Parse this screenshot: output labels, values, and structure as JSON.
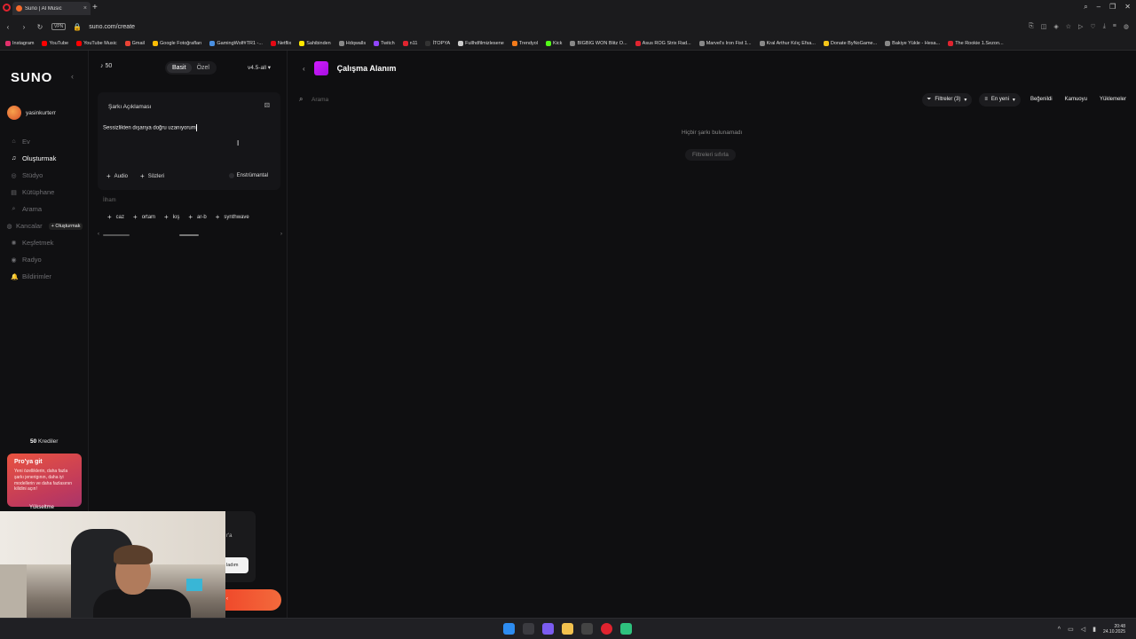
{
  "browser": {
    "tab_title": "Suno | AI Music",
    "url": "suno.com/create",
    "vpn_label": "VPN",
    "bookmarks": [
      {
        "label": "Instagram",
        "color": "#e1306c"
      },
      {
        "label": "YouTube",
        "color": "#ff0000"
      },
      {
        "label": "YouTube Music",
        "color": "#ff0000"
      },
      {
        "label": "Gmail",
        "color": "#ea4335"
      },
      {
        "label": "Google Fotoğrafları",
        "color": "#fbbc05"
      },
      {
        "label": "GamingWolf#TR1 -...",
        "color": "#4a90e2"
      },
      {
        "label": "Netflix",
        "color": "#e50914"
      },
      {
        "label": "Sahibinden",
        "color": "#ffe800"
      },
      {
        "label": "Hdqwalls",
        "color": "#888888"
      },
      {
        "label": "Twitch",
        "color": "#9146ff"
      },
      {
        "label": "n11",
        "color": "#e0242f"
      },
      {
        "label": "İTOPYA",
        "color": "#333333"
      },
      {
        "label": "Fullhdfilmizlesene",
        "color": "#cccccc"
      },
      {
        "label": "Trendyol",
        "color": "#f27a1a"
      },
      {
        "label": "Kick",
        "color": "#53fc18"
      },
      {
        "label": "BIGBIG WON Blitz O...",
        "color": "#888888"
      },
      {
        "label": "Asus ROG Strix Rad...",
        "color": "#e0242f"
      },
      {
        "label": "Marvel's Iron Fist 1...",
        "color": "#888888"
      },
      {
        "label": "Kral Arthur Kılıç Efsa...",
        "color": "#888888"
      },
      {
        "label": "Donate ByNoGame...",
        "color": "#f5c518"
      },
      {
        "label": "Bakiye Yükle - Hesa...",
        "color": "#888888"
      },
      {
        "label": "The Rookie 1.Sezon...",
        "color": "#e0242f"
      }
    ]
  },
  "sidebar": {
    "logo": "SUNO",
    "username": "yasinkurterr",
    "nav": [
      {
        "label": "Ev",
        "icon": "home-icon",
        "glyph": "⌂",
        "active": false
      },
      {
        "label": "Oluşturmak",
        "icon": "music-note-icon",
        "glyph": "♫",
        "active": true
      },
      {
        "label": "Stüdyo",
        "icon": "studio-icon",
        "glyph": "◎",
        "active": false
      },
      {
        "label": "Kütüphane",
        "icon": "library-icon",
        "glyph": "▤",
        "active": false
      },
      {
        "label": "Arama",
        "icon": "search-icon",
        "glyph": "⌕",
        "active": false
      }
    ],
    "hooks": {
      "label": "Kancalar",
      "badge": "+ Oluşturmak"
    },
    "nav2": [
      {
        "label": "Keşfetmek",
        "icon": "explore-icon",
        "glyph": "✺"
      },
      {
        "label": "Radyo",
        "icon": "radio-icon",
        "glyph": "◉"
      },
      {
        "label": "Bildirimler",
        "icon": "bell-icon",
        "glyph": "🔔"
      }
    ],
    "credits_count": "50",
    "credits_label": "Krediler",
    "pro": {
      "title": "Pro'ya git",
      "text": "Yeni özelliklerin, daha fazla şarkı jenerigının, daha iyi modellerin ve daha fazlasının kilidini açın!",
      "button": "Yükseltme"
    }
  },
  "overlay": {
    "popup_text": "r'a",
    "popup_button": "ladım"
  },
  "create": {
    "credits": "50",
    "mode_simple": "Basit",
    "mode_custom": "Özel",
    "version": "v4.5-all",
    "song_label": "Şarkı Açıklaması",
    "song_value": "Sessizlikten dışarıya doğru uzanıyorum",
    "chip_audio": "Audio",
    "chip_lyrics": "Sözleri",
    "instrumental": "Enstrümantal",
    "inspiration_label": "İlham",
    "tags": [
      "caz",
      "ortam",
      "kış",
      "ar-b",
      "synthwave"
    ]
  },
  "workspace": {
    "title": "Çalışma Alanım",
    "search_placeholder": "Arama",
    "filters_label": "Filtreler (3)",
    "sort_label": "En yeni",
    "liked_label": "Beğenildi",
    "public_label": "Kamuoyu",
    "uploads_label": "Yüklemeler",
    "empty_message": "Hiçbir şarkı bulunamadı",
    "reset_label": "Filtreleri sıfırla",
    "thumb_color": "#d21cff"
  },
  "taskbar": {
    "time": "20:48",
    "date": "24.10.2025"
  }
}
